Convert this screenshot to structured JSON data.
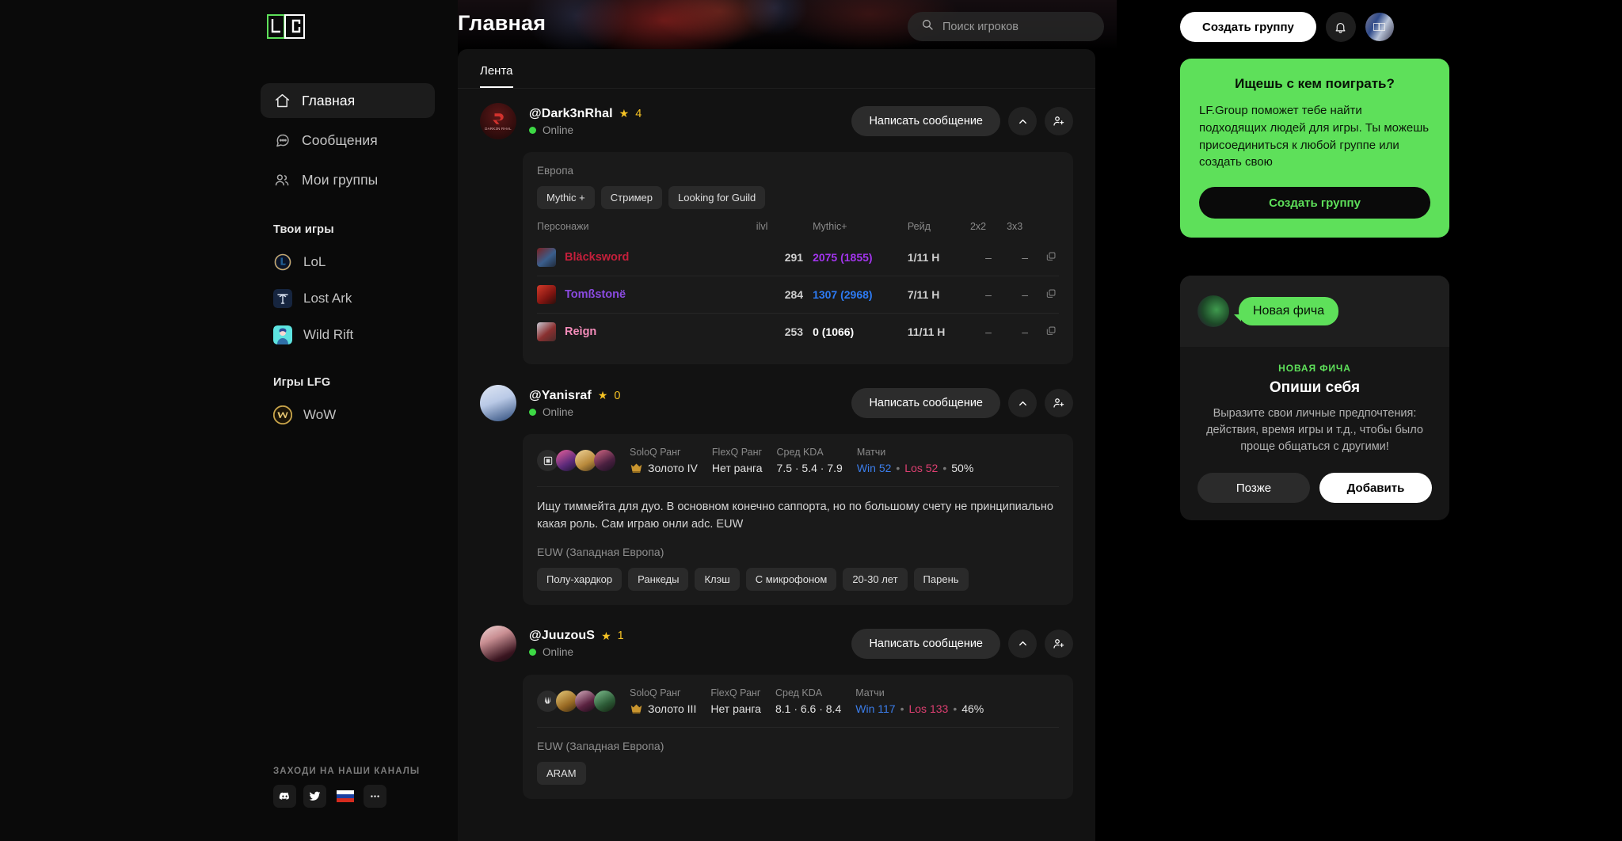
{
  "sidebar": {
    "logo_text": "LFG",
    "nav": [
      {
        "label": "Главная",
        "icon": "home-icon",
        "active": true
      },
      {
        "label": "Сообщения",
        "icon": "chat-icon",
        "active": false
      },
      {
        "label": "Мои группы",
        "icon": "people-icon",
        "active": false
      }
    ],
    "your_games_title": "Твои игры",
    "your_games": [
      {
        "label": "LoL",
        "icon": "lol-icon"
      },
      {
        "label": "Lost Ark",
        "icon": "lost-ark-icon"
      },
      {
        "label": "Wild Rift",
        "icon": "wild-rift-icon"
      }
    ],
    "lfg_games_title": "Игры LFG",
    "lfg_games": [
      {
        "label": "WoW",
        "icon": "wow-icon"
      }
    ],
    "channels_title": "ЗАХОДИ НА НАШИ КАНАЛЫ",
    "channels": [
      {
        "name": "discord-icon"
      },
      {
        "name": "twitter-icon"
      },
      {
        "name": "russia-flag-icon"
      },
      {
        "name": "more-icon"
      }
    ]
  },
  "header": {
    "title": "Главная",
    "search_placeholder": "Поиск игроков",
    "search_value": "",
    "search_icon": "search-icon",
    "create_group_label": "Создать группу",
    "bell_icon": "bell-icon",
    "avatar_icon": "user-avatar"
  },
  "feed": {
    "tabs": [
      {
        "label": "Лента",
        "active": true
      }
    ],
    "posts": [
      {
        "username": "@Dark3nRhal",
        "rating": "4",
        "status": "Online",
        "message_label": "Написать сообщение",
        "collapse_icon": "chevron-up-icon",
        "add_friend_icon": "add-person-icon",
        "avatar_label": "DARK3N RHAL",
        "type": "wow",
        "region": "Европа",
        "tags": [
          "Mythic +",
          "Стример",
          "Looking for Guild"
        ],
        "table": {
          "headers": [
            "Персонажи",
            "ilvl",
            "Mythic+",
            "Рейд",
            "2x2",
            "3x3"
          ],
          "rows": [
            {
              "name": "Bläcksword",
              "color": "#c41f3b",
              "ilvl": "291",
              "mythic": "2075 (1855)",
              "mythic_color": "#a335ee",
              "raid": "1/11 H",
              "pvp2": "–",
              "pvp3": "–"
            },
            {
              "name": "Tomßstonë",
              "color": "#8a4ae0",
              "ilvl": "284",
              "mythic": "1307 (2968)",
              "mythic_color": "#2d7bf4",
              "raid": "7/11 H",
              "pvp2": "–",
              "pvp3": "–"
            },
            {
              "name": "Reìgn",
              "color": "#f48cba",
              "ilvl": "253",
              "mythic": "0 (1066)",
              "mythic_color": "#ffffff",
              "raid": "11/11 H",
              "pvp2": "–",
              "pvp3": "–"
            }
          ]
        }
      },
      {
        "username": "@Yanisraf",
        "rating": "0",
        "status": "Online",
        "message_label": "Написать сообщение",
        "collapse_icon": "chevron-up-icon",
        "add_friend_icon": "add-person-icon",
        "type": "lol",
        "stats": {
          "soloq_label": "SoloQ Ранг",
          "soloq_value": "Золото IV",
          "flexq_label": "FlexQ Ранг",
          "flexq_value": "Нет ранга",
          "kda_label": "Сред KDA",
          "kda_value": "7.5 · 5.4 · 7.9",
          "matches_label": "Матчи",
          "wins": "Win 52",
          "losses": "Los 52",
          "winrate": "50%"
        },
        "text": "Ищу тиммейта для дуо. В основном конечно саппорта, но по большому счету не принципиально какая роль. Сам играю онли adc. EUW",
        "region": "EUW (Западная Европа)",
        "tags": [
          "Полу-хардкор",
          "Ранкеды",
          "Клэш",
          "С микрофоном",
          "20-30 лет",
          "Парень"
        ]
      },
      {
        "username": "@JuuzouS",
        "rating": "1",
        "status": "Online",
        "message_label": "Написать сообщение",
        "collapse_icon": "chevron-up-icon",
        "add_friend_icon": "add-person-icon",
        "type": "lol",
        "stats": {
          "soloq_label": "SoloQ Ранг",
          "soloq_value": "Золото III",
          "flexq_label": "FlexQ Ранг",
          "flexq_value": "Нет ранга",
          "kda_label": "Сред KDA",
          "kda_value": "8.1 · 6.6 · 8.4",
          "matches_label": "Матчи",
          "wins": "Win 117",
          "losses": "Los 133",
          "winrate": "46%"
        },
        "region": "EUW (Западная Европа)",
        "tags": [
          "ARAM"
        ]
      }
    ]
  },
  "rail": {
    "promo": {
      "title": "Ищешь с кем поиграть?",
      "body": "LF.Group поможет тебе найти подходящих людей для игры. Ты можешь присоединиться к любой группе или создать свою",
      "button": "Создать группу"
    },
    "feature": {
      "bubble": "Новая фича",
      "kicker": "НОВАЯ ФИЧА",
      "title": "Опиши себя",
      "desc": "Выразите свои личные предпочтения: действия, время игры и т.д., чтобы было проще общаться с другими!",
      "later_label": "Позже",
      "add_label": "Добавить"
    }
  },
  "colors": {
    "accent_green": "#5ee05a",
    "bg": "#000000",
    "card": "#121212",
    "inner_card": "#1a1a1a"
  }
}
